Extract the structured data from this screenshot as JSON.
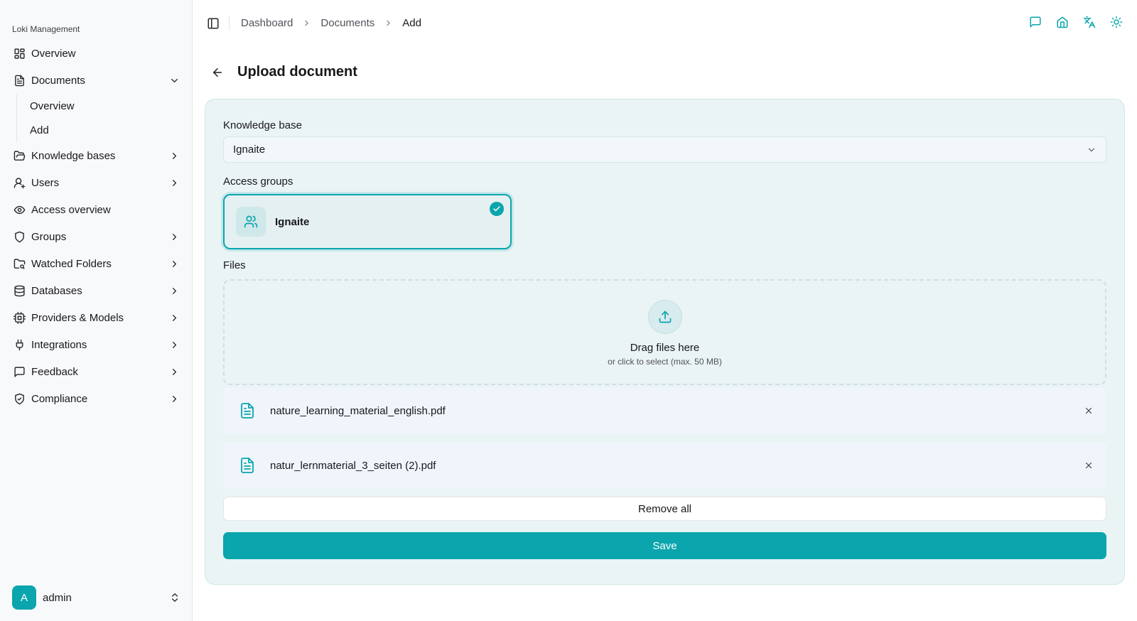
{
  "sidebar": {
    "title": "Loki Management",
    "items": [
      {
        "label": "Overview",
        "icon": "grid-icon"
      },
      {
        "label": "Documents",
        "icon": "document-icon",
        "expanded": true
      },
      {
        "label": "Knowledge bases",
        "icon": "folder-open-icon"
      },
      {
        "label": "Users",
        "icon": "user-plus-icon"
      },
      {
        "label": "Access overview",
        "icon": "eye-icon"
      },
      {
        "label": "Groups",
        "icon": "shield-icon"
      },
      {
        "label": "Watched Folders",
        "icon": "folder-search-icon"
      },
      {
        "label": "Databases",
        "icon": "database-icon"
      },
      {
        "label": "Providers & Models",
        "icon": "cpu-icon"
      },
      {
        "label": "Integrations",
        "icon": "plug-icon"
      },
      {
        "label": "Feedback",
        "icon": "message-icon"
      },
      {
        "label": "Compliance",
        "icon": "shield-check-icon"
      }
    ],
    "documents_sub": [
      {
        "label": "Overview"
      },
      {
        "label": "Add"
      }
    ],
    "user": {
      "initial": "A",
      "name": "admin"
    }
  },
  "breadcrumb": [
    "Dashboard",
    "Documents",
    "Add"
  ],
  "top_icons": [
    "chat-icon",
    "home-icon",
    "translate-icon",
    "sun-icon"
  ],
  "page": {
    "title": "Upload document"
  },
  "form": {
    "knowledge_base_label": "Knowledge base",
    "knowledge_base_value": "Ignaite",
    "access_groups_label": "Access groups",
    "access_group": {
      "name": "Ignaite",
      "selected": true
    },
    "files_label": "Files",
    "dropzone": {
      "title": "Drag files here",
      "subtitle": "or click to select (max. 50 MB)"
    },
    "files": [
      {
        "name": "nature_learning_material_english.pdf"
      },
      {
        "name": "natur_lernmaterial_3_seiten (2).pdf"
      }
    ],
    "remove_all_label": "Remove all",
    "save_label": "Save"
  },
  "colors": {
    "accent": "#0aa5ad",
    "card_bg": "#eaf4f5",
    "sidebar_bg": "#f8f9fa"
  }
}
